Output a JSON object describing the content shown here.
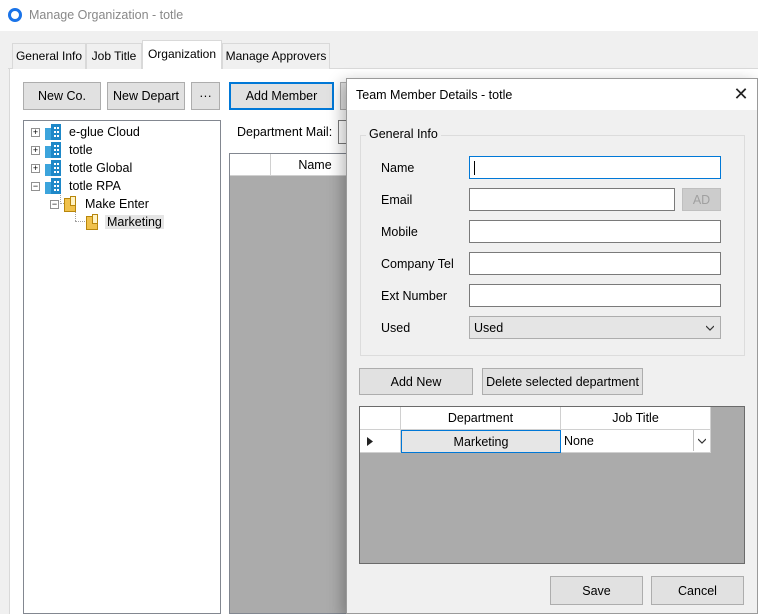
{
  "window": {
    "title": "Manage Organization - totle"
  },
  "tabs": [
    {
      "label": "General Info"
    },
    {
      "label": "Job Title"
    },
    {
      "label": "Organization"
    },
    {
      "label": "Manage Approvers"
    }
  ],
  "toolbar": {
    "new_co": "New Co.",
    "new_depart": "New Depart",
    "more": "···",
    "add_member": "Add Member"
  },
  "tree": {
    "items": [
      {
        "label": "e-glue Cloud"
      },
      {
        "label": "totle"
      },
      {
        "label": "totle Global"
      },
      {
        "label": "totle RPA"
      },
      {
        "label": "Make Enter"
      },
      {
        "label": "Marketing"
      }
    ]
  },
  "main": {
    "department_mail_label": "Department Mail:",
    "grid_name_header": "Name"
  },
  "dialog": {
    "title": "Team Member Details - totle",
    "close": "✕",
    "group_title": "General Info",
    "fields": {
      "name_label": "Name",
      "name_value": "",
      "email_label": "Email",
      "email_value": "",
      "ad_button": "AD",
      "mobile_label": "Mobile",
      "mobile_value": "",
      "company_tel_label": "Company Tel",
      "company_tel_value": "",
      "ext_number_label": "Ext Number",
      "ext_number_value": "",
      "used_label": "Used",
      "used_value": "Used"
    },
    "add_new": "Add New",
    "delete_department": "Delete selected department",
    "grid": {
      "headers": [
        "Department",
        "Job Title"
      ],
      "rows": [
        {
          "department": "Marketing",
          "job_title": "None"
        }
      ]
    },
    "save": "Save",
    "cancel": "Cancel"
  },
  "colors": {
    "accent": "#0078d7",
    "grid_background": "#ababab",
    "org_icon": "#1e88c8",
    "dept_icon": "#f0c14b"
  }
}
